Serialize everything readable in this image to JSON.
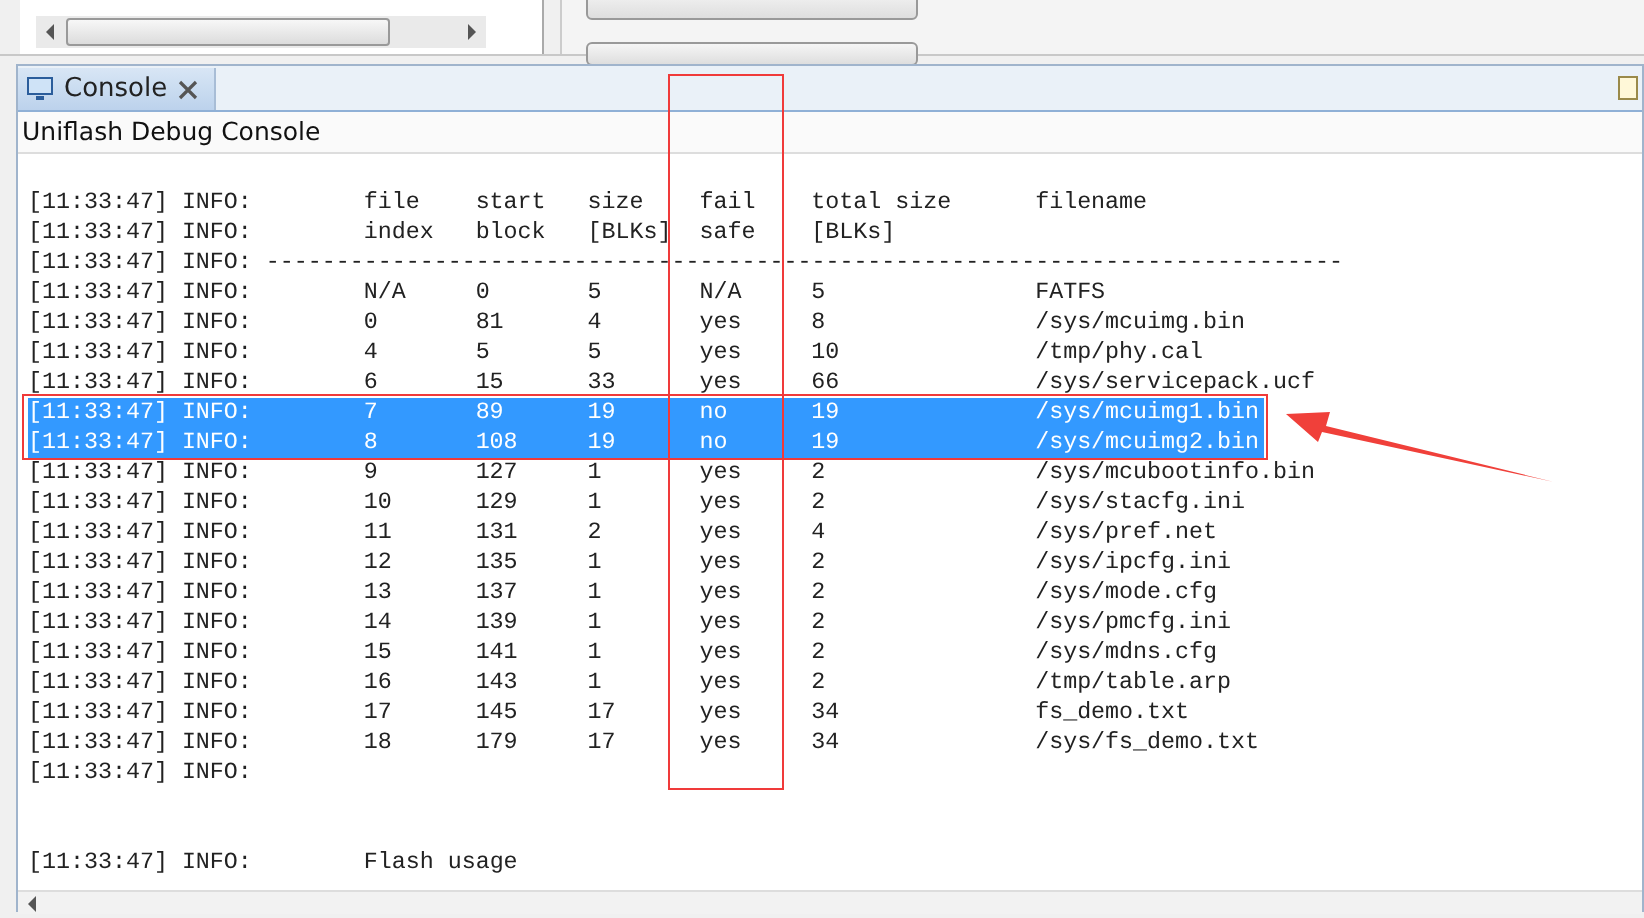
{
  "console_view": {
    "tab": {
      "label": "Console",
      "selected": true
    },
    "title": "Uniflash Debug Console"
  },
  "lines": [
    {
      "kind": "blank"
    },
    {
      "kind": "table",
      "selected": false,
      "timestamp": "[11:33:47]",
      "level": "INFO:",
      "cells": [
        "file",
        "start",
        "size",
        "fail",
        "total size",
        "filename"
      ]
    },
    {
      "kind": "table",
      "selected": false,
      "timestamp": "[11:33:47]",
      "level": "INFO:",
      "cells": [
        "index",
        "block",
        "[BLKs]",
        "safe",
        "[BLKs]"
      ]
    },
    {
      "kind": "divider",
      "selected": false,
      "timestamp": "[11:33:47]",
      "level": "INFO:",
      "message": "-----------------------------------------------------------------------------"
    },
    {
      "kind": "table",
      "selected": false,
      "timestamp": "[11:33:47]",
      "level": "INFO:",
      "cells": [
        "N/A",
        "0",
        "5",
        "N/A",
        "5",
        "FATFS"
      ]
    },
    {
      "kind": "table",
      "selected": false,
      "timestamp": "[11:33:47]",
      "level": "INFO:",
      "cells": [
        "0",
        "81",
        "4",
        "yes",
        "8",
        "/sys/mcuimg.bin"
      ]
    },
    {
      "kind": "table",
      "selected": false,
      "timestamp": "[11:33:47]",
      "level": "INFO:",
      "cells": [
        "4",
        "5",
        "5",
        "yes",
        "10",
        "/tmp/phy.cal"
      ]
    },
    {
      "kind": "table",
      "selected": false,
      "timestamp": "[11:33:47]",
      "level": "INFO:",
      "cells": [
        "6",
        "15",
        "33",
        "yes",
        "66",
        "/sys/servicepack.ucf"
      ]
    },
    {
      "kind": "table",
      "selected": true,
      "timestamp": "[11:33:47]",
      "level": "INFO:",
      "cells": [
        "7",
        "89",
        "19",
        "no",
        "19",
        "/sys/mcuimg1.bin"
      ]
    },
    {
      "kind": "table",
      "selected": true,
      "timestamp": "[11:33:47]",
      "level": "INFO:",
      "cells": [
        "8",
        "108",
        "19",
        "no",
        "19",
        "/sys/mcuimg2.bin"
      ]
    },
    {
      "kind": "table",
      "selected": false,
      "timestamp": "[11:33:47]",
      "level": "INFO:",
      "cells": [
        "9",
        "127",
        "1",
        "yes",
        "2",
        "/sys/mcubootinfo.bin"
      ]
    },
    {
      "kind": "table",
      "selected": false,
      "timestamp": "[11:33:47]",
      "level": "INFO:",
      "cells": [
        "10",
        "129",
        "1",
        "yes",
        "2",
        "/sys/stacfg.ini"
      ]
    },
    {
      "kind": "table",
      "selected": false,
      "timestamp": "[11:33:47]",
      "level": "INFO:",
      "cells": [
        "11",
        "131",
        "2",
        "yes",
        "4",
        "/sys/pref.net"
      ]
    },
    {
      "kind": "table",
      "selected": false,
      "timestamp": "[11:33:47]",
      "level": "INFO:",
      "cells": [
        "12",
        "135",
        "1",
        "yes",
        "2",
        "/sys/ipcfg.ini"
      ]
    },
    {
      "kind": "table",
      "selected": false,
      "timestamp": "[11:33:47]",
      "level": "INFO:",
      "cells": [
        "13",
        "137",
        "1",
        "yes",
        "2",
        "/sys/mode.cfg"
      ]
    },
    {
      "kind": "table",
      "selected": false,
      "timestamp": "[11:33:47]",
      "level": "INFO:",
      "cells": [
        "14",
        "139",
        "1",
        "yes",
        "2",
        "/sys/pmcfg.ini"
      ]
    },
    {
      "kind": "table",
      "selected": false,
      "timestamp": "[11:33:47]",
      "level": "INFO:",
      "cells": [
        "15",
        "141",
        "1",
        "yes",
        "2",
        "/sys/mdns.cfg"
      ]
    },
    {
      "kind": "table",
      "selected": false,
      "timestamp": "[11:33:47]",
      "level": "INFO:",
      "cells": [
        "16",
        "143",
        "1",
        "yes",
        "2",
        "/tmp/table.arp"
      ]
    },
    {
      "kind": "table",
      "selected": false,
      "timestamp": "[11:33:47]",
      "level": "INFO:",
      "cells": [
        "17",
        "145",
        "17",
        "yes",
        "34",
        "fs_demo.txt"
      ]
    },
    {
      "kind": "table",
      "selected": false,
      "timestamp": "[11:33:47]",
      "level": "INFO:",
      "cells": [
        "18",
        "179",
        "17",
        "yes",
        "34",
        "/sys/fs_demo.txt"
      ]
    },
    {
      "kind": "table",
      "selected": false,
      "timestamp": "[11:33:47]",
      "level": "INFO:"
    },
    {
      "kind": "blank"
    },
    {
      "kind": "blank"
    },
    {
      "kind": "table",
      "selected": false,
      "timestamp": "[11:33:47]",
      "level": "INFO:",
      "cells": [
        "Flash usage"
      ]
    }
  ]
}
